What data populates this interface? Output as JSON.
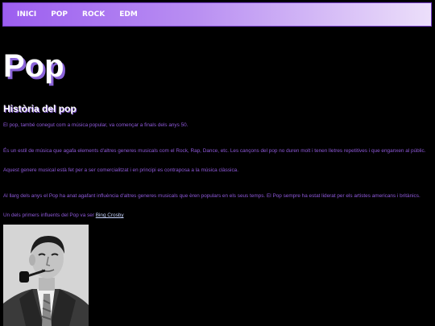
{
  "nav": {
    "items": [
      "INICI",
      "POP",
      "ROCK",
      "EDM"
    ]
  },
  "page": {
    "title": "Pop",
    "section_title": "Història del pop"
  },
  "content": {
    "p1": "El pop, també conegut com a música popular, va començar a finals dels anys 50.",
    "p2": "És un estil de música que agafa elements d'altres generes musicals com el Rock, Rap, Dance, etc. Les cançons del pop no duren molt i tenen lletres repetitives i que enganxen al públic.",
    "p3": "Aquest genere musical està fet per a ser comercialitzat i en principi es contraposa a la música clàssica.",
    "p4": "Al llarg dels anys el Pop ha anat agafant influència d'altres generes musicals que èren populars en els seus temps. El Pop sempre ha estat liderat per els artistes americans i britànics.",
    "p5_prefix": "Un dels primers influents del Pop va ser ",
    "p5_link": "Bing Crosby"
  },
  "colors": {
    "accent": "#9c5ef0",
    "text": "#8e58d9",
    "link": "#c9d6ff"
  }
}
